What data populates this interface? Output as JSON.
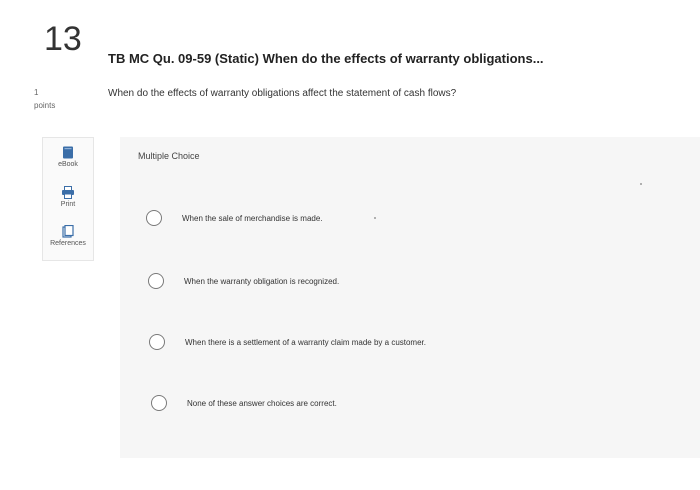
{
  "question": {
    "number": "13",
    "points_value": "1",
    "points_label": "points",
    "title": "TB MC Qu. 09-59 (Static) When do the effects of warranty obligations...",
    "prompt": "When do the effects of warranty obligations affect the statement of cash flows?"
  },
  "tools": [
    {
      "label": "eBook",
      "icon": "book-icon"
    },
    {
      "label": "Print",
      "icon": "printer-icon"
    },
    {
      "label": "References",
      "icon": "references-icon"
    }
  ],
  "multiple_choice": {
    "label": "Multiple Choice",
    "options": [
      "When the sale of merchandise is made.",
      "When the warranty obligation is recognized.",
      "When there is a settlement of a warranty claim made by a customer.",
      "None of these answer choices are correct."
    ]
  },
  "colors": {
    "accent": "#3b6ea8",
    "panel_bg": "#f6f6f6"
  }
}
